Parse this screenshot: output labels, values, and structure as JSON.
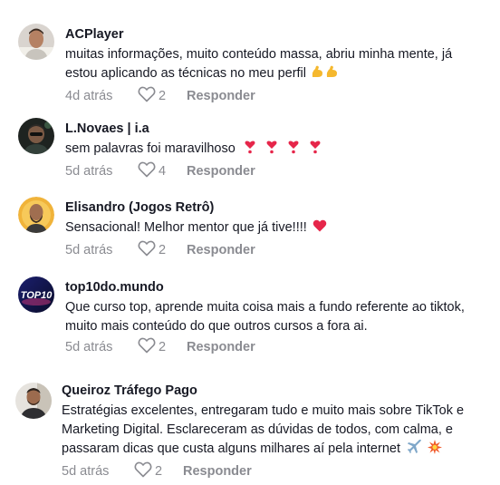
{
  "comments": [
    {
      "username": "ACPlayer",
      "lines": [
        "muitas informações, muito conteúdo massa, abriu minha mente, já",
        "estou aplicando as técnicas no meu perfil"
      ],
      "emoji": [
        "flexed-biceps",
        "flexed-biceps"
      ],
      "time": "4d atrás",
      "likes": "2",
      "reply": "Responder"
    },
    {
      "username": "L.Novaes | i.a",
      "lines": [
        "sem palavras foi maravilhoso"
      ],
      "emoji": [
        "heart-exclamation",
        "heart-exclamation",
        "heart-exclamation",
        "heart-exclamation"
      ],
      "time": "5d atrás",
      "likes": "4",
      "reply": "Responder"
    },
    {
      "username": "Elisandro (Jogos Retrô)",
      "lines": [
        "Sensacional! Melhor mentor que já tive!!!!"
      ],
      "emoji": [
        "red-heart"
      ],
      "time": "5d atrás",
      "likes": "2",
      "reply": "Responder"
    },
    {
      "username": "top10do.mundo",
      "avatar_text": "TOP10",
      "lines": [
        "Que curso top, aprende muita coisa mais a fundo referente ao tiktok,",
        "muito mais conteúdo do que outros cursos a fora ai."
      ],
      "emoji": [],
      "time": "5d atrás",
      "likes": "2",
      "reply": "Responder"
    },
    {
      "username": "Queiroz Tráfego Pago",
      "lines": [
        "Estratégias excelentes, entregaram tudo e muito mais sobre TikTok e",
        "Marketing Digital. Esclareceram as dúvidas de todos, com calma, e",
        "passaram dicas que custa alguns milhares aí pela internet"
      ],
      "emoji": [
        "airplane",
        "collision"
      ],
      "time": "5d atrás",
      "likes": "2",
      "reply": "Responder"
    }
  ],
  "colors": {
    "text": "#161823",
    "muted": "#8a8b91"
  }
}
